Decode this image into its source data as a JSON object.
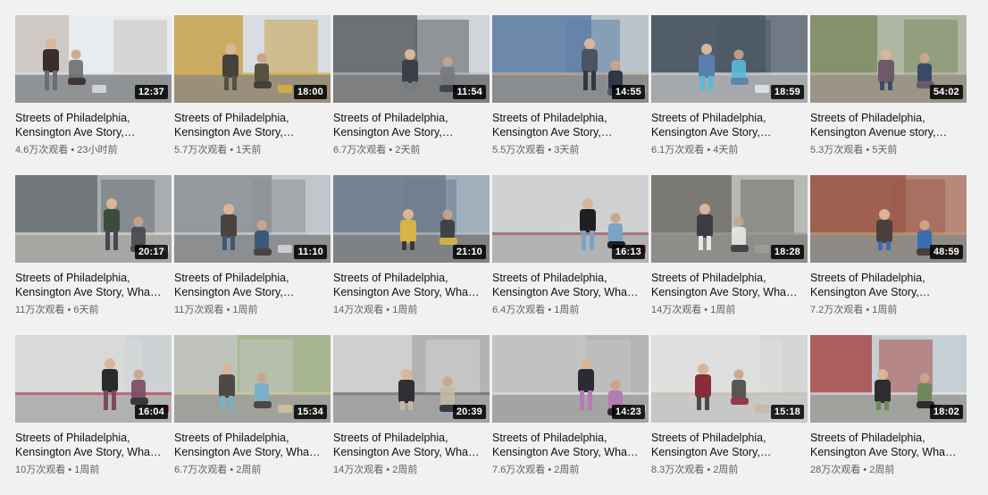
{
  "videos": [
    {
      "title": "Streets of Philadelphia, Kensington Ave Story,…",
      "duration": "12:37",
      "views": "4.6万次观看",
      "age": "23小时前"
    },
    {
      "title": "Streets of Philadelphia, Kensington Ave Story,…",
      "duration": "18:00",
      "views": "5.7万次观看",
      "age": "1天前"
    },
    {
      "title": "Streets of Philadelphia, Kensington Ave Story,…",
      "duration": "11:54",
      "views": "6.7万次观看",
      "age": "2天前"
    },
    {
      "title": "Streets of Philadelphia, Kensington Ave Story,…",
      "duration": "14:55",
      "views": "5.5万次观看",
      "age": "3天前"
    },
    {
      "title": "Streets of Philadelphia, Kensington Ave Story,…",
      "duration": "18:59",
      "views": "6.1万次观看",
      "age": "4天前"
    },
    {
      "title": "Streets of Philadelphia, Kensington Avenue story,…",
      "duration": "54:02",
      "views": "5.3万次观看",
      "age": "5天前"
    },
    {
      "title": "Streets of Philadelphia, Kensington Ave Story, Wha…",
      "duration": "20:17",
      "views": "11万次观看",
      "age": "6天前"
    },
    {
      "title": "Streets of Philadelphia, Kensington Ave Story,…",
      "duration": "11:10",
      "views": "11万次观看",
      "age": "1周前"
    },
    {
      "title": "Streets of Philadelphia, Kensington Ave Story, Wha…",
      "duration": "21:10",
      "views": "14万次观看",
      "age": "1周前"
    },
    {
      "title": "Streets of Philadelphia, Kensington Ave Story, Wha…",
      "duration": "16:13",
      "views": "6.4万次观看",
      "age": "1周前"
    },
    {
      "title": "Streets of Philadelphia, Kensington Ave Story, Wha…",
      "duration": "18:28",
      "views": "14万次观看",
      "age": "1周前"
    },
    {
      "title": "Streets of Philadelphia, Kensington Ave Story,…",
      "duration": "48:59",
      "views": "7.2万次观看",
      "age": "1周前"
    },
    {
      "title": "Streets of Philadelphia, Kensington Ave Story, Wha…",
      "duration": "16:04",
      "views": "10万次观看",
      "age": "1周前"
    },
    {
      "title": "Streets of Philadelphia, Kensington Ave Story, Wha…",
      "duration": "15:34",
      "views": "6.7万次观看",
      "age": "2周前"
    },
    {
      "title": "Streets of Philadelphia, Kensington Ave Story, Wha…",
      "duration": "20:39",
      "views": "14万次观看",
      "age": "2周前"
    },
    {
      "title": "Streets of Philadelphia, Kensington Ave Story, Wha…",
      "duration": "14:23",
      "views": "7.6万次观看",
      "age": "2周前"
    },
    {
      "title": "Streets of Philadelphia, Kensington Ave Story,…",
      "duration": "15:18",
      "views": "8.3万次观看",
      "age": "2周前"
    },
    {
      "title": "Streets of Philadelphia, Kensington Ave Story, Wha…",
      "duration": "18:02",
      "views": "28万次观看",
      "age": "2周前"
    }
  ],
  "meta_separator": " • ",
  "colors": {
    "background": "#f1f1f1",
    "title_text": "#0f0f0f",
    "meta_text": "#606060",
    "duration_badge": "#000000"
  }
}
